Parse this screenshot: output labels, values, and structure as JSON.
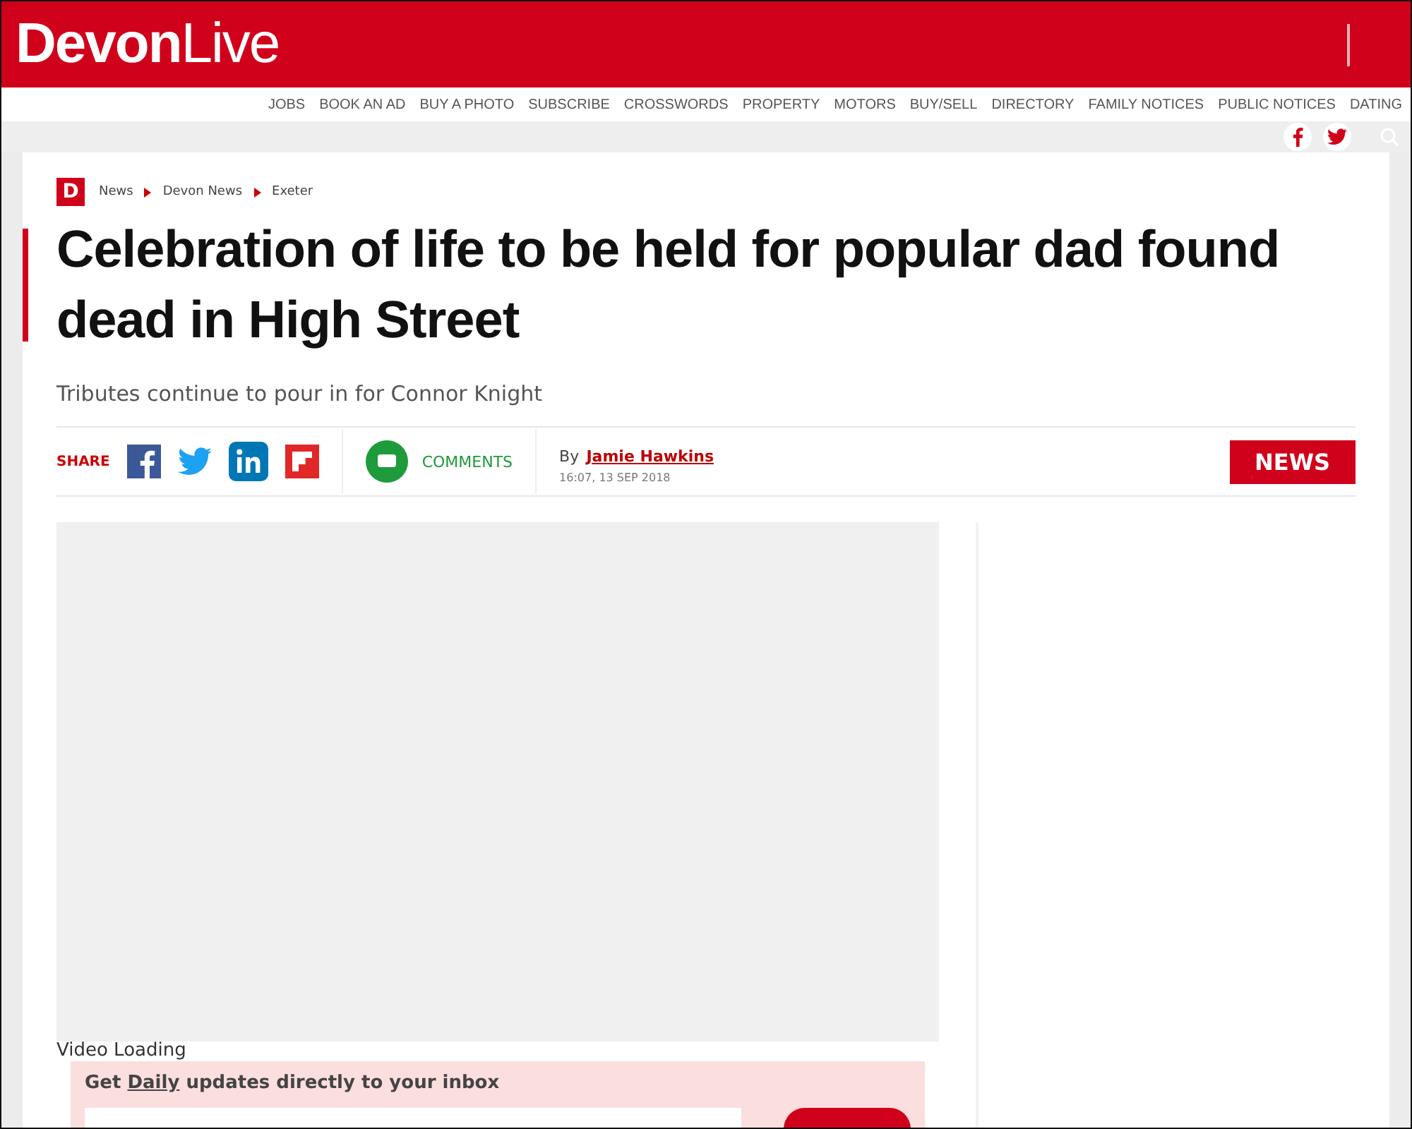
{
  "header": {
    "logo": {
      "bold": "Devon",
      "light": "Live"
    }
  },
  "top_links": [
    "JOBS",
    "BOOK AN AD",
    "BUY A PHOTO",
    "SUBSCRIBE",
    "CROSSWORDS",
    "PROPERTY",
    "MOTORS",
    "BUY/SELL",
    "DIRECTORY",
    "FAMILY NOTICES",
    "PUBLIC NOTICES",
    "DATING"
  ],
  "breadcrumb": {
    "badge": "D",
    "items": [
      "News",
      "Devon News",
      "Exeter"
    ]
  },
  "article": {
    "headline": "Celebration of life to be held for popular dad found dead in High Street",
    "standfirst": "Tributes continue to pour in for Connor Knight",
    "share_label": "SHARE",
    "comments_label": "COMMENTS",
    "byline_prefix": "By",
    "author": "Jamie Hawkins",
    "timestamp": "16:07, 13 SEP 2018",
    "category": "NEWS"
  },
  "video": {
    "status": "Video Loading"
  },
  "newsletter": {
    "title_before": "Get ",
    "title_link": "Daily",
    "title_after": " updates directly to your inbox"
  }
}
